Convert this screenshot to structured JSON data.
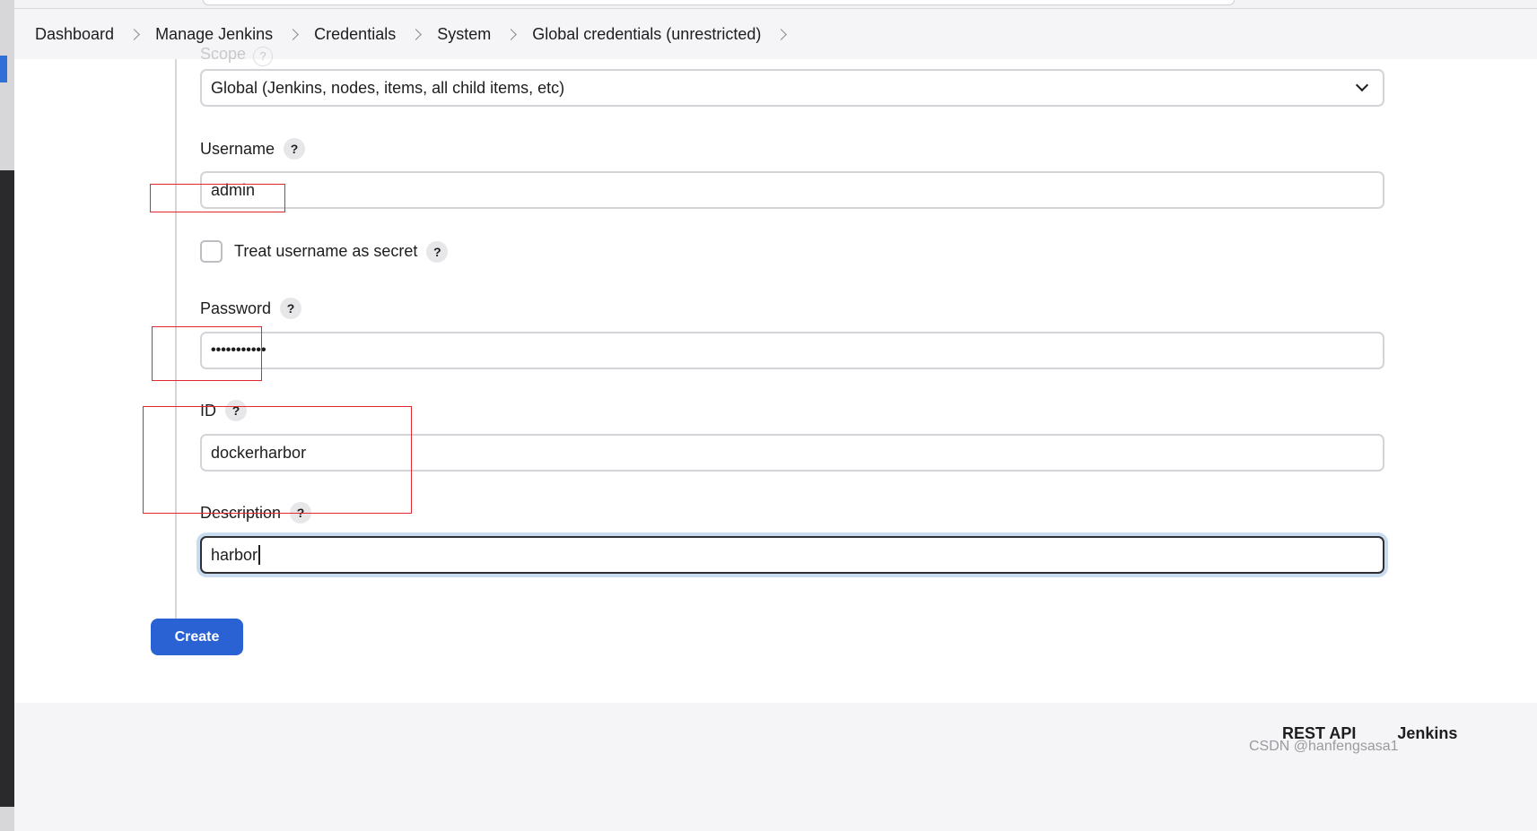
{
  "breadcrumb": [
    {
      "label": "Dashboard"
    },
    {
      "label": "Manage Jenkins"
    },
    {
      "label": "Credentials"
    },
    {
      "label": "System"
    },
    {
      "label": "Global credentials (unrestricted)"
    }
  ],
  "form": {
    "scope": {
      "label": "Scope",
      "value": "Global (Jenkins, nodes, items, all child items, etc)"
    },
    "username": {
      "label": "Username",
      "value": "admin"
    },
    "treat_secret": {
      "label": "Treat username as secret",
      "checked": false
    },
    "password": {
      "label": "Password",
      "value": "•••••••••••"
    },
    "id": {
      "label": "ID",
      "value": "dockerharbor"
    },
    "description": {
      "label": "Description",
      "value": "harbor"
    },
    "help_symbol": "?"
  },
  "create_button": {
    "label": "Create"
  },
  "footer": {
    "links": [
      "REST API",
      "Jenkins"
    ]
  },
  "watermark": "CSDN @hanfengsasa1",
  "colors": {
    "primary": "#2a62d4",
    "annotation": "#e0282e",
    "focus_ring": "#c9dbee"
  }
}
